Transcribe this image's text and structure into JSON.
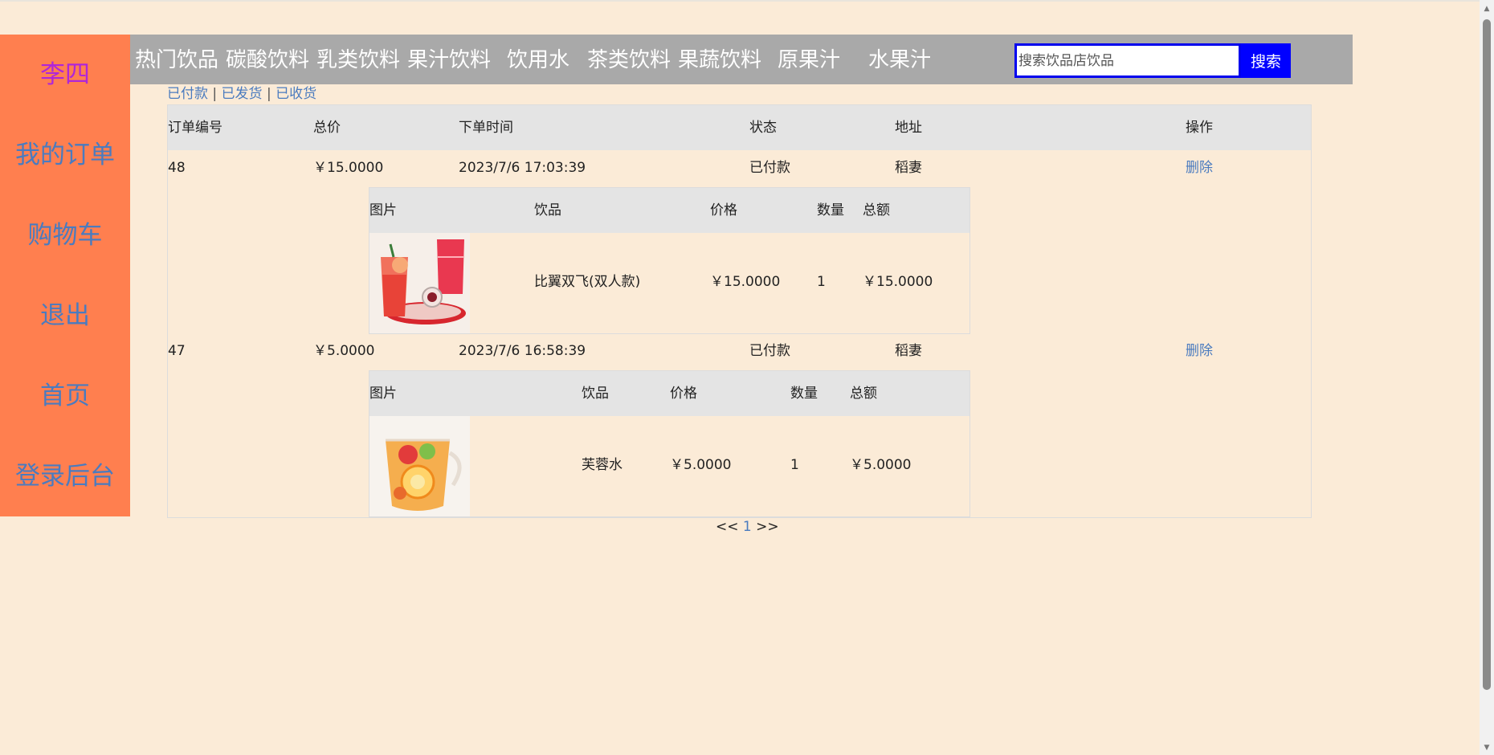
{
  "sidebar": {
    "user": "李四",
    "items": [
      "我的订单",
      "购物车",
      "退出",
      "首页",
      "登录后台"
    ]
  },
  "nav": {
    "categories": [
      "热门饮品",
      "碳酸饮料",
      "乳类饮料",
      "果汁饮料",
      "饮用水",
      "茶类饮料",
      "果蔬饮料",
      "原果汁",
      "水果汁"
    ]
  },
  "search": {
    "placeholder": "搜索饮品店饮品",
    "button": "搜索"
  },
  "filters": {
    "paid": "已付款",
    "shipped": "已发货",
    "received": "已收货",
    "separator": "|"
  },
  "table": {
    "headers": [
      "订单编号",
      "总价",
      "下单时间",
      "状态",
      "地址",
      "操作"
    ],
    "sub_headers": [
      "图片",
      "饮品",
      "价格",
      "数量",
      "总额"
    ],
    "orders": [
      {
        "id": "48",
        "total": "￥15.0000",
        "time": "2023/7/6 17:03:39",
        "status": "已付款",
        "address": "稻妻",
        "action": "删除",
        "item": {
          "name": "比翼双飞(双人款)",
          "price": "￥15.0000",
          "qty": "1",
          "amount": "￥15.0000",
          "image_icon": "red-drinks-photo"
        }
      },
      {
        "id": "47",
        "total": "￥5.0000",
        "time": "2023/7/6 16:58:39",
        "status": "已付款",
        "address": "稻妻",
        "action": "删除",
        "item": {
          "name": "芙蓉水",
          "price": "￥5.0000",
          "qty": "1",
          "amount": "￥5.0000",
          "image_icon": "orange-tea-photo"
        }
      }
    ]
  },
  "pager": {
    "prev": "<<",
    "page": "1",
    "next": ">>"
  },
  "colors": {
    "background": "#fbebd7",
    "sidebar": "#ff7f4f",
    "navbar": "#a9a9a9",
    "link": "#4a7bbf",
    "search_button": "#0000ff"
  }
}
